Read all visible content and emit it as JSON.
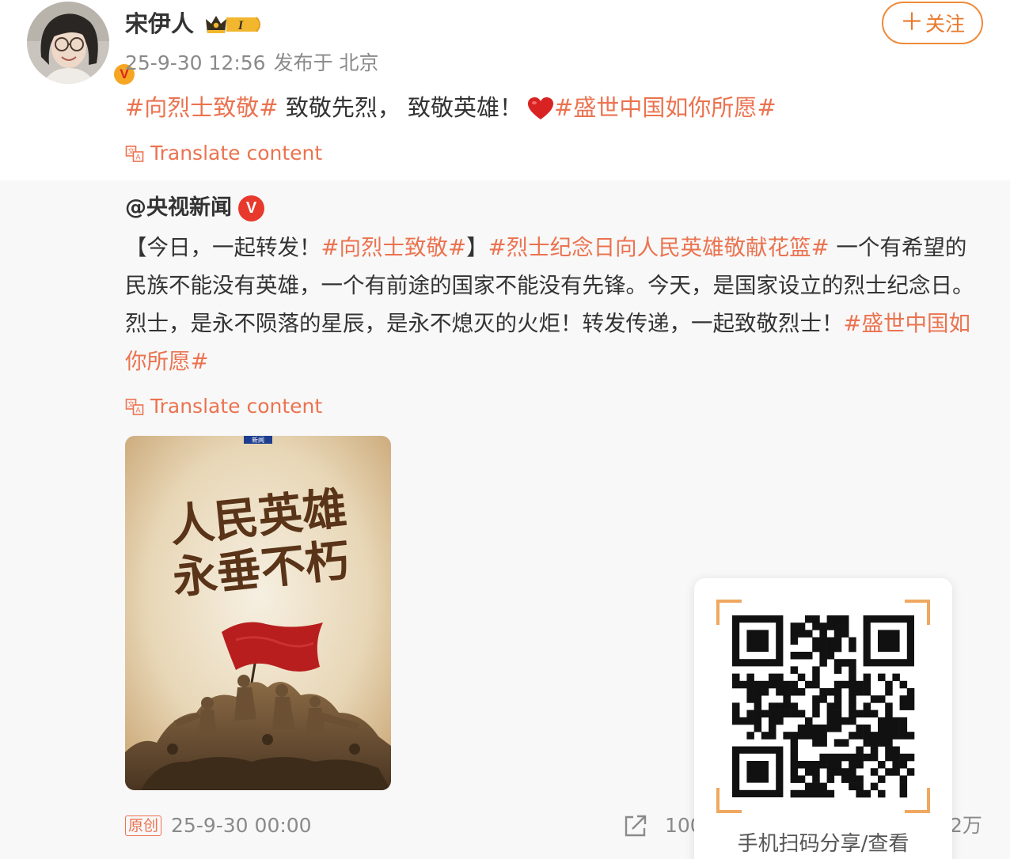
{
  "post": {
    "author": "宋伊人",
    "badge_level": "I",
    "meta_time": "25-9-30 12:56",
    "meta_source": "发布于 北京",
    "follow_label": "关注",
    "topic1": "#向烈士致敬#",
    "text1": " 致敬先烈， 致敬英雄！",
    "topic2": "#盛世中国如你所愿#",
    "translate_label": "Translate content"
  },
  "repost": {
    "author": "@央视新闻",
    "verified_mark": "V",
    "part1": "【今日，一起转发！",
    "topic1": "#向烈士致敬#",
    "part2": "】",
    "topic2": "#烈士纪念日向人民英雄敬献花篮#",
    "part3": " 一个有希望的民族不能没有英雄，一个有前途的国家不能没有先锋。今天，是国家设立的烈士纪念日。烈士，是永不陨落的星辰，是永不熄灭的火炬！转发传递，一起致敬烈士！",
    "topic3": "#盛世中国如你所愿#",
    "translate_label": "Translate content",
    "image": {
      "channel_tag": "新闻",
      "title_line1": "人民英雄",
      "title_line2": "永垂不朽"
    },
    "original_tag": "原创",
    "time": "25-9-30 00:00",
    "share_count": "100",
    "like_count": "2万"
  },
  "qr": {
    "caption": "手机扫码分享/查看"
  },
  "colors": {
    "accent": "#eb7350",
    "follow_border": "#ef8a3a",
    "text": "#333333",
    "meta": "#8a8a8a",
    "background": "#f8f8f8"
  },
  "icons": [
    "verified-badge-icon",
    "crown-badge-icon",
    "heart-icon",
    "translate-icon",
    "share-icon",
    "v-verified-icon"
  ]
}
